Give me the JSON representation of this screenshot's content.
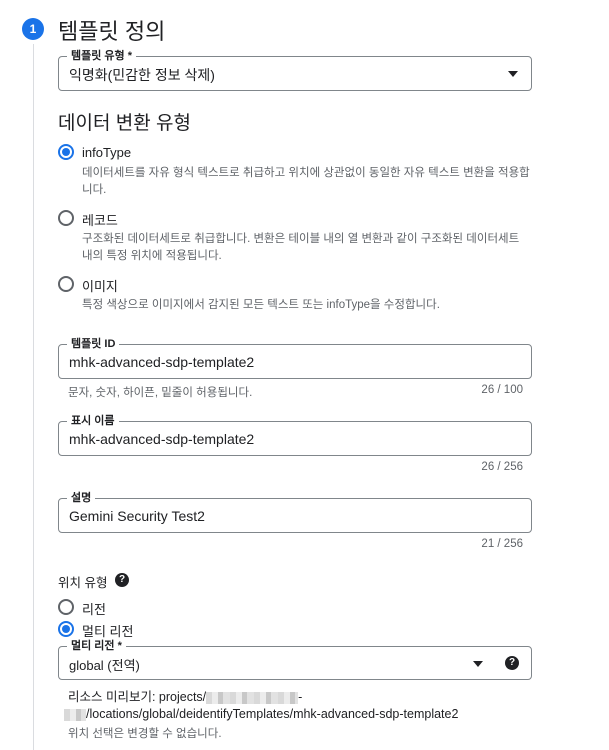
{
  "step": {
    "number": "1",
    "title": "템플릿 정의"
  },
  "template_type": {
    "label": "템플릿 유형 *",
    "value": "익명화(민감한 정보 삭제)"
  },
  "transform_section": {
    "title": "데이터 변환 유형",
    "options": [
      {
        "label": "infoType",
        "description": "데이터세트를 자유 형식 텍스트로 취급하고 위치에 상관없이 동일한 자유 텍스트 변환을 적용합니다.",
        "checked": true
      },
      {
        "label": "레코드",
        "description": "구조화된 데이터세트로 취급합니다. 변환은 테이블 내의 열 변환과 같이 구조화된 데이터세트 내의 특정 위치에 적용됩니다.",
        "checked": false
      },
      {
        "label": "이미지",
        "description": "특정 색상으로 이미지에서 감지된 모든 텍스트 또는 infoType을 수정합니다.",
        "checked": false
      }
    ]
  },
  "template_id": {
    "label": "템플릿 ID",
    "value": "mhk-advanced-sdp-template2",
    "hint": "문자, 숫자, 하이픈, 밑줄이 허용됩니다.",
    "counter": "26 / 100"
  },
  "display_name": {
    "label": "표시 이름",
    "value": "mhk-advanced-sdp-template2",
    "counter": "26 / 256"
  },
  "description_field": {
    "label": "설명",
    "value": "Gemini Security Test2",
    "counter": "21 / 256"
  },
  "location": {
    "title": "위치 유형",
    "help_icon": "help-icon",
    "options": [
      {
        "label": "리전",
        "checked": false
      },
      {
        "label": "멀티 리전",
        "checked": true
      }
    ],
    "multi_region_label": "멀티 리전 *",
    "multi_region_value": "global (전역)",
    "resource_preview_label": "리소스 미리보기: projects/",
    "resource_preview_suffix": "-",
    "resource_preview_line2": "/locations/global/deidentifyTemplates/mhk-advanced-sdp-template2",
    "location_note": "위치 선택은 변경할 수 없습니다."
  },
  "colors": {
    "accent": "#1a73e8",
    "text": "#202124",
    "secondary": "#5f6368",
    "border": "#80868b"
  }
}
